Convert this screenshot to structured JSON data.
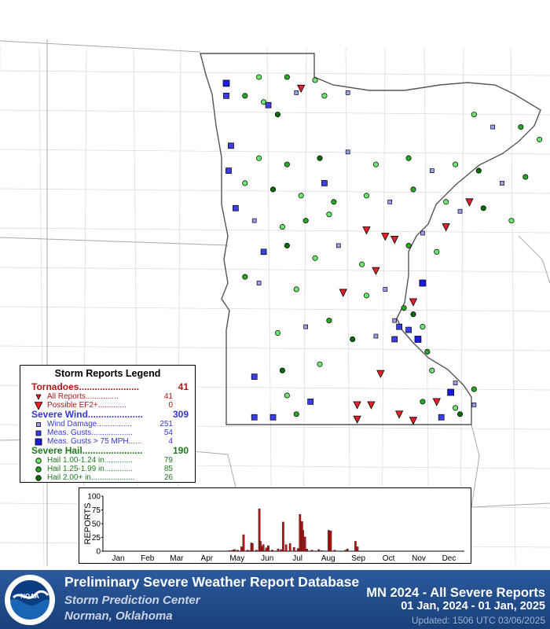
{
  "map": {
    "state": "MN",
    "colors": {
      "tornado": "#e8202a",
      "wind_damage": "#9d9ff0",
      "gust": "#3d3fe6",
      "gust_75": "#1a1ae0",
      "hail_1": "#6ee66e",
      "hail_2": "#2aa52a",
      "hail_3": "#0a6a0a"
    },
    "markers": [
      {
        "t": "h1",
        "lon": -96.2,
        "lat": 49.0
      },
      {
        "t": "h2",
        "lon": -95.6,
        "lat": 49.0
      },
      {
        "t": "h1",
        "lon": -95.0,
        "lat": 48.95
      },
      {
        "t": "wd",
        "lon": -95.4,
        "lat": 48.75
      },
      {
        "t": "g",
        "lon": -96.9,
        "lat": 48.7
      },
      {
        "t": "h2",
        "lon": -96.5,
        "lat": 48.7
      },
      {
        "t": "h1",
        "lon": -96.1,
        "lat": 48.6
      },
      {
        "t": "h3",
        "lon": -95.8,
        "lat": 48.4
      },
      {
        "t": "tor",
        "lon": -95.3,
        "lat": 48.82
      },
      {
        "t": "h1",
        "lon": -94.8,
        "lat": 48.7
      },
      {
        "t": "wd",
        "lon": -94.3,
        "lat": 48.75
      },
      {
        "t": "g",
        "lon": -96.0,
        "lat": 48.55
      },
      {
        "t": "h1",
        "lon": -91.6,
        "lat": 48.4
      },
      {
        "t": "wd",
        "lon": -91.2,
        "lat": 48.2
      },
      {
        "t": "h2",
        "lon": -90.6,
        "lat": 48.2
      },
      {
        "t": "h1",
        "lon": -90.2,
        "lat": 48.0
      },
      {
        "t": "g",
        "lon": -96.8,
        "lat": 47.9
      },
      {
        "t": "h1",
        "lon": -96.2,
        "lat": 47.7
      },
      {
        "t": "h2",
        "lon": -95.6,
        "lat": 47.6
      },
      {
        "t": "h3",
        "lon": -94.9,
        "lat": 47.7
      },
      {
        "t": "wd",
        "lon": -94.3,
        "lat": 47.8
      },
      {
        "t": "h1",
        "lon": -93.7,
        "lat": 47.6
      },
      {
        "t": "h2",
        "lon": -93.0,
        "lat": 47.7
      },
      {
        "t": "wd",
        "lon": -92.5,
        "lat": 47.5
      },
      {
        "t": "h1",
        "lon": -92.0,
        "lat": 47.6
      },
      {
        "t": "h3",
        "lon": -91.5,
        "lat": 47.5
      },
      {
        "t": "wd",
        "lon": -91.0,
        "lat": 47.3
      },
      {
        "t": "h2",
        "lon": -90.5,
        "lat": 47.4
      },
      {
        "t": "g",
        "lon": -96.85,
        "lat": 47.5
      },
      {
        "t": "h1",
        "lon": -96.5,
        "lat": 47.3
      },
      {
        "t": "h3",
        "lon": -95.9,
        "lat": 47.2
      },
      {
        "t": "h1",
        "lon": -95.3,
        "lat": 47.1
      },
      {
        "t": "g",
        "lon": -94.8,
        "lat": 47.3
      },
      {
        "t": "h2",
        "lon": -94.6,
        "lat": 47.0
      },
      {
        "t": "h1",
        "lon": -93.9,
        "lat": 47.1
      },
      {
        "t": "wd",
        "lon": -93.4,
        "lat": 47.0
      },
      {
        "t": "h2",
        "lon": -92.9,
        "lat": 47.2
      },
      {
        "t": "h1",
        "lon": -92.2,
        "lat": 47.0
      },
      {
        "t": "tor",
        "lon": -91.7,
        "lat": 47.0
      },
      {
        "t": "wd",
        "lon": -91.9,
        "lat": 46.85
      },
      {
        "t": "h3",
        "lon": -91.4,
        "lat": 46.9
      },
      {
        "t": "h1",
        "lon": -90.8,
        "lat": 46.7
      },
      {
        "t": "g",
        "lon": -96.7,
        "lat": 46.9
      },
      {
        "t": "wd",
        "lon": -96.3,
        "lat": 46.7
      },
      {
        "t": "h1",
        "lon": -95.7,
        "lat": 46.6
      },
      {
        "t": "h2",
        "lon": -95.2,
        "lat": 46.7
      },
      {
        "t": "h1",
        "lon": -94.7,
        "lat": 46.8
      },
      {
        "t": "tor",
        "lon": -93.9,
        "lat": 46.55
      },
      {
        "t": "tor",
        "lon": -93.5,
        "lat": 46.45
      },
      {
        "t": "tor",
        "lon": -93.3,
        "lat": 46.4
      },
      {
        "t": "tor",
        "lon": -92.2,
        "lat": 46.6
      },
      {
        "t": "wd",
        "lon": -92.7,
        "lat": 46.5
      },
      {
        "t": "h2",
        "lon": -93.0,
        "lat": 46.3
      },
      {
        "t": "h1",
        "lon": -92.4,
        "lat": 46.2
      },
      {
        "t": "g",
        "lon": -96.1,
        "lat": 46.2
      },
      {
        "t": "h3",
        "lon": -95.6,
        "lat": 46.3
      },
      {
        "t": "h1",
        "lon": -95.0,
        "lat": 46.1
      },
      {
        "t": "wd",
        "lon": -94.5,
        "lat": 46.3
      },
      {
        "t": "h1",
        "lon": -94.0,
        "lat": 46.0
      },
      {
        "t": "tor",
        "lon": -93.7,
        "lat": 45.9
      },
      {
        "t": "h2",
        "lon": -96.5,
        "lat": 45.8
      },
      {
        "t": "wd",
        "lon": -96.2,
        "lat": 45.7
      },
      {
        "t": "h1",
        "lon": -95.4,
        "lat": 45.6
      },
      {
        "t": "tor",
        "lon": -94.4,
        "lat": 45.55
      },
      {
        "t": "h1",
        "lon": -93.9,
        "lat": 45.5
      },
      {
        "t": "wd",
        "lon": -93.5,
        "lat": 45.6
      },
      {
        "t": "h2",
        "lon": -93.1,
        "lat": 45.3
      },
      {
        "t": "h3",
        "lon": -92.9,
        "lat": 45.2
      },
      {
        "t": "tor",
        "lon": -92.9,
        "lat": 45.4
      },
      {
        "t": "wd",
        "lon": -93.3,
        "lat": 45.1
      },
      {
        "t": "g",
        "lon": -93.2,
        "lat": 45.0
      },
      {
        "t": "g",
        "lon": -93.0,
        "lat": 44.95
      },
      {
        "t": "h1",
        "lon": -92.7,
        "lat": 45.0
      },
      {
        "t": "h2",
        "lon": -94.7,
        "lat": 45.1
      },
      {
        "t": "wd",
        "lon": -95.2,
        "lat": 45.0
      },
      {
        "t": "h1",
        "lon": -95.8,
        "lat": 44.9
      },
      {
        "t": "h3",
        "lon": -94.2,
        "lat": 44.8
      },
      {
        "t": "wd",
        "lon": -93.7,
        "lat": 44.85
      },
      {
        "t": "g",
        "lon": -93.3,
        "lat": 44.8
      },
      {
        "t": "h2",
        "lon": -92.6,
        "lat": 44.6
      },
      {
        "t": "tor",
        "lon": -93.6,
        "lat": 44.25
      },
      {
        "t": "h1",
        "lon": -94.9,
        "lat": 44.4
      },
      {
        "t": "g",
        "lon": -96.3,
        "lat": 44.2
      },
      {
        "t": "h3",
        "lon": -95.7,
        "lat": 44.3
      },
      {
        "t": "h1",
        "lon": -92.5,
        "lat": 44.3
      },
      {
        "t": "wd",
        "lon": -92.0,
        "lat": 44.1
      },
      {
        "t": "h2",
        "lon": -91.6,
        "lat": 44.0
      },
      {
        "t": "tor",
        "lon": -94.1,
        "lat": 43.75
      },
      {
        "t": "tor",
        "lon": -93.8,
        "lat": 43.75
      },
      {
        "t": "g",
        "lon": -95.1,
        "lat": 43.8
      },
      {
        "t": "h1",
        "lon": -95.6,
        "lat": 43.9
      },
      {
        "t": "tor",
        "lon": -93.2,
        "lat": 43.6
      },
      {
        "t": "h2",
        "lon": -92.7,
        "lat": 43.8
      },
      {
        "t": "tor",
        "lon": -92.4,
        "lat": 43.8
      },
      {
        "t": "h1",
        "lon": -92.0,
        "lat": 43.7
      },
      {
        "t": "wd",
        "lon": -91.6,
        "lat": 43.75
      },
      {
        "t": "g",
        "lon": -96.3,
        "lat": 43.55
      },
      {
        "t": "g",
        "lon": -95.9,
        "lat": 43.55
      },
      {
        "t": "h2",
        "lon": -95.4,
        "lat": 43.6
      },
      {
        "t": "tor",
        "lon": -94.1,
        "lat": 43.52
      },
      {
        "t": "tor",
        "lon": -92.9,
        "lat": 43.5
      },
      {
        "t": "g",
        "lon": -92.3,
        "lat": 43.55
      },
      {
        "t": "h3",
        "lon": -91.9,
        "lat": 43.6
      },
      {
        "t": "gx",
        "lon": -92.8,
        "lat": 44.8
      },
      {
        "t": "gx",
        "lon": -92.1,
        "lat": 43.95
      },
      {
        "t": "gx",
        "lon": -96.9,
        "lat": 48.9
      },
      {
        "t": "gx",
        "lon": -92.7,
        "lat": 45.7
      }
    ]
  },
  "legend": {
    "title": "Storm Reports Legend",
    "tornadoes": {
      "label": "Tornadoes.......................",
      "count": "41",
      "items": [
        {
          "label": "All Reports...............",
          "count": "41"
        },
        {
          "label": "Possible EF2+.............",
          "count": "0"
        }
      ]
    },
    "wind": {
      "label": "Severe Wind.....................",
      "count": "309",
      "items": [
        {
          "label": "Wind Damage................",
          "count": "251"
        },
        {
          "label": "Meas. Gusts...................",
          "count": "54"
        },
        {
          "label": "Meas. Gusts > 75 MPH......",
          "count": "4"
        }
      ]
    },
    "hail": {
      "label": "Severe Hail.......................",
      "count": "190",
      "items": [
        {
          "label": "Hail 1.00-1.24 in.............",
          "count": "79"
        },
        {
          "label": "Hail 1.25-1.99 in.............",
          "count": "85"
        },
        {
          "label": "Hail 2.00+ in....................",
          "count": "26"
        }
      ]
    }
  },
  "chart_data": {
    "type": "bar",
    "ylabel": "REPORTS",
    "ylim": [
      0,
      100
    ],
    "yticks": [
      0,
      25,
      50,
      75,
      100
    ],
    "month_labels": [
      "Jan",
      "Feb",
      "Mar",
      "Apr",
      "May",
      "Jun",
      "Jul",
      "Aug",
      "Sep",
      "Oct",
      "Nov",
      "Dec"
    ],
    "x_unit": "day_of_year",
    "bar_color": "#b01818",
    "bars": [
      {
        "day": 129,
        "value": 1
      },
      {
        "day": 132,
        "value": 2
      },
      {
        "day": 134,
        "value": 3
      },
      {
        "day": 137,
        "value": 2
      },
      {
        "day": 141,
        "value": 8
      },
      {
        "day": 143,
        "value": 30
      },
      {
        "day": 147,
        "value": 2
      },
      {
        "day": 149,
        "value": 1
      },
      {
        "day": 151,
        "value": 15
      },
      {
        "day": 152,
        "value": 14
      },
      {
        "day": 156,
        "value": 2
      },
      {
        "day": 159,
        "value": 77
      },
      {
        "day": 160,
        "value": 18
      },
      {
        "day": 162,
        "value": 9
      },
      {
        "day": 163,
        "value": 12
      },
      {
        "day": 166,
        "value": 6
      },
      {
        "day": 168,
        "value": 10
      },
      {
        "day": 172,
        "value": 2
      },
      {
        "day": 178,
        "value": 4
      },
      {
        "day": 181,
        "value": 3
      },
      {
        "day": 183,
        "value": 53
      },
      {
        "day": 186,
        "value": 12
      },
      {
        "day": 190,
        "value": 14
      },
      {
        "day": 194,
        "value": 7
      },
      {
        "day": 198,
        "value": 5
      },
      {
        "day": 200,
        "value": 67
      },
      {
        "day": 202,
        "value": 54
      },
      {
        "day": 203,
        "value": 38
      },
      {
        "day": 205,
        "value": 26
      },
      {
        "day": 207,
        "value": 4
      },
      {
        "day": 212,
        "value": 2
      },
      {
        "day": 219,
        "value": 3
      },
      {
        "day": 222,
        "value": 1
      },
      {
        "day": 229,
        "value": 38
      },
      {
        "day": 231,
        "value": 37
      },
      {
        "day": 235,
        "value": 2
      },
      {
        "day": 246,
        "value": 2
      },
      {
        "day": 248,
        "value": 4
      },
      {
        "day": 256,
        "value": 18
      },
      {
        "day": 258,
        "value": 8
      }
    ]
  },
  "footer": {
    "title": "Preliminary Severe Weather Report Database",
    "org1": "Storm Prediction Center",
    "org2": "Norman, Oklahoma",
    "state_title": "MN  2024 - All Severe Reports",
    "range": "01 Jan, 2024 - 01 Jan, 2025",
    "updated": "Updated: 1506 UTC 03/06/2025",
    "logo_text": "NOAA"
  }
}
